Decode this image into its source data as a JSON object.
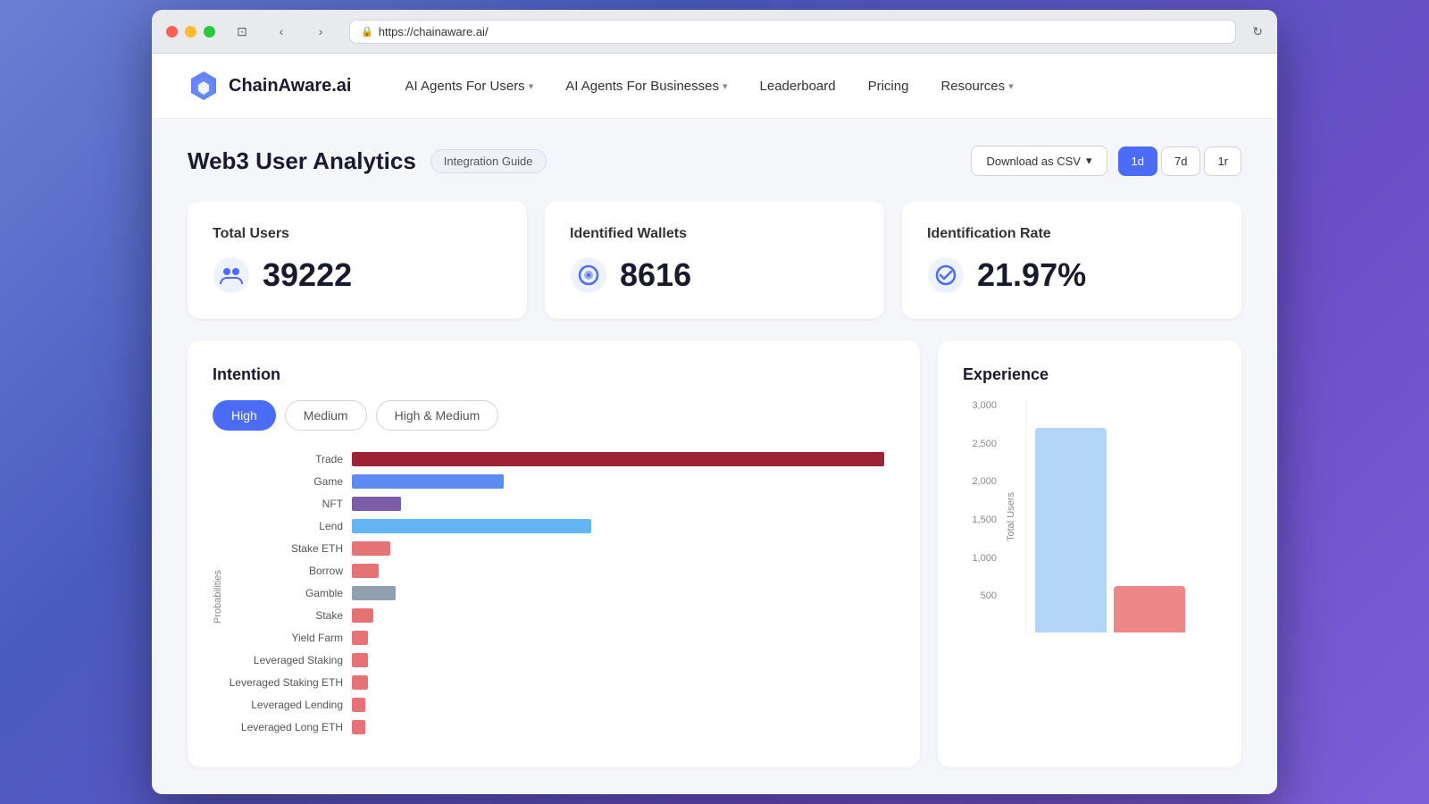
{
  "browser": {
    "url": "https://chainaware.ai/",
    "tab_title": "ChainAware.ai"
  },
  "navbar": {
    "logo_text": "ChainAware.ai",
    "nav_items": [
      {
        "id": "ai-users",
        "label": "AI Agents For Users",
        "has_dropdown": true
      },
      {
        "id": "ai-businesses",
        "label": "AI Agents For Businesses",
        "has_dropdown": true
      },
      {
        "id": "leaderboard",
        "label": "Leaderboard",
        "has_dropdown": false
      },
      {
        "id": "pricing",
        "label": "Pricing",
        "has_dropdown": false
      },
      {
        "id": "resources",
        "label": "Resources",
        "has_dropdown": true
      }
    ]
  },
  "page": {
    "title": "Web3 User Analytics",
    "integration_badge": "Integration Guide",
    "download_btn": "Download as CSV",
    "time_filters": [
      "1d",
      "7d",
      "1r"
    ],
    "active_time": "1d"
  },
  "stats": [
    {
      "id": "total-users",
      "label": "Total Users",
      "value": "39222",
      "icon": "users-icon"
    },
    {
      "id": "identified-wallets",
      "label": "Identified Wallets",
      "value": "8616",
      "icon": "wallet-icon"
    },
    {
      "id": "identification-rate",
      "label": "Identification Rate",
      "value": "21.97%",
      "icon": "rate-icon"
    }
  ],
  "intention": {
    "title": "Intention",
    "filters": [
      "High",
      "Medium",
      "High & Medium"
    ],
    "active_filter": "High",
    "probabilities_label": "Probabilities",
    "bars": [
      {
        "label": "Trade",
        "value": 98,
        "color": "crimson"
      },
      {
        "label": "Game",
        "value": 32,
        "color": "blue"
      },
      {
        "label": "NFT",
        "value": 10,
        "color": "purple"
      },
      {
        "label": "Lend",
        "value": 45,
        "color": "light-blue"
      },
      {
        "label": "Stake ETH",
        "value": 8,
        "color": "pink"
      },
      {
        "label": "Borrow",
        "value": 6,
        "color": "pink"
      },
      {
        "label": "Gamble",
        "value": 9,
        "color": "gray"
      },
      {
        "label": "Stake",
        "value": 5,
        "color": "pink"
      },
      {
        "label": "Yield Farm",
        "value": 4,
        "color": "pink"
      },
      {
        "label": "Leveraged Staking",
        "value": 4,
        "color": "pink"
      },
      {
        "label": "Leveraged Staking ETH",
        "value": 3,
        "color": "pink"
      },
      {
        "label": "Leveraged Lending",
        "value": 3,
        "color": "pink"
      },
      {
        "label": "Leveraged Long ETH",
        "value": 3,
        "color": "pink"
      }
    ]
  },
  "experience": {
    "title": "Experience",
    "y_labels": [
      "3,000",
      "2,500",
      "2,000",
      "1,500",
      "1,000",
      "500",
      ""
    ],
    "total_users_label": "Total Users",
    "bars": [
      {
        "height": 90,
        "color": "blue"
      },
      {
        "height": 20,
        "color": "red"
      }
    ]
  }
}
